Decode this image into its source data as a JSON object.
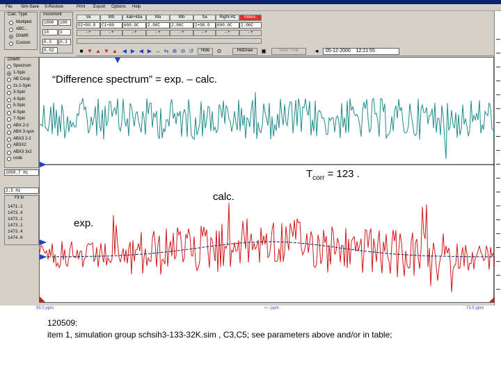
{
  "menu": [
    "File",
    "Sim-Save",
    "S-Restore",
    "Print",
    "Export",
    "Options",
    "Help"
  ],
  "calc_type": {
    "title": "Calc. Type",
    "options": [
      "Multiplet",
      "ABC...",
      "DNMR",
      "Custom"
    ],
    "selected": "DNMR"
  },
  "increment": {
    "title": "Increment",
    "rows": [
      [
        "1000",
        "100"
      ],
      [
        "10",
        "3"
      ],
      [
        "0.3",
        "0.1"
      ],
      [
        "0.02",
        ""
      ]
    ]
  },
  "param_columns": [
    {
      "label": "Va",
      "value": "02+00.0",
      "highlight": false
    },
    {
      "label": "Wb",
      "value": "C1+00",
      "highlight": false
    },
    {
      "label": "kab+kba",
      "value": "600.0C",
      "highlight": false
    },
    {
      "label": "Wa",
      "value": "2.00C",
      "highlight": false
    },
    {
      "label": "Wb",
      "value": "2.00C",
      "highlight": false
    },
    {
      "label": "Sa",
      "value": "2+00.0",
      "highlight": false
    },
    {
      "label": "Right-Hz",
      "value": "600.0C",
      "highlight": false
    },
    {
      "label": "Intens.",
      "value": "2.00C",
      "highlight": true
    }
  ],
  "toolbar": {
    "hide_label": "Hide",
    "hidedraw_label": "HidDraw",
    "stickfull_label": "Stick / Full",
    "date": "05-12-2000",
    "time": "12:21:55"
  },
  "dnmr": {
    "title": "DNMR",
    "items": [
      "Spectrum",
      "1-Spin",
      "AB Coup",
      "2x 2-Spin",
      "3-Spin",
      "4-Spin",
      "5-Spin",
      "6-Spin",
      "7-Spin",
      "ABX 2-2",
      "ABX 3-spin",
      "ABX3 2-2",
      "AB3X2",
      "ABX3 3x2",
      "code"
    ]
  },
  "hz_field": "2058.7 Hz",
  "hz_field2": "2.5 Hz",
  "fit_title": "Fit to",
  "fit_values": [
    "1471.1",
    "1473.4",
    "1473.1",
    "1473.1",
    "1473.4",
    "1474.0"
  ],
  "axis": {
    "left_ppm": "95.0 ppm",
    "center_label": "<-- ppm",
    "right_ppm": "73.5 ppm"
  },
  "annotations": {
    "difference": "“Difference spectrum” = exp. – calc.",
    "tcorr_prefix": "T",
    "tcorr_sub": "corr",
    "tcorr_suffix": " = 123 .",
    "calc": "calc.",
    "exp": "exp."
  },
  "caption": {
    "line1": "120509:",
    "line2": "item 1, simulation group schsih3-133-32K.sim ,  C3,C5; see parameters above and/or in table;"
  },
  "colors": {
    "difference_trace": "#1f8a8a",
    "exp_trace": "#d01818",
    "calc_trace": "#102070",
    "marker": "#2040c0"
  }
}
